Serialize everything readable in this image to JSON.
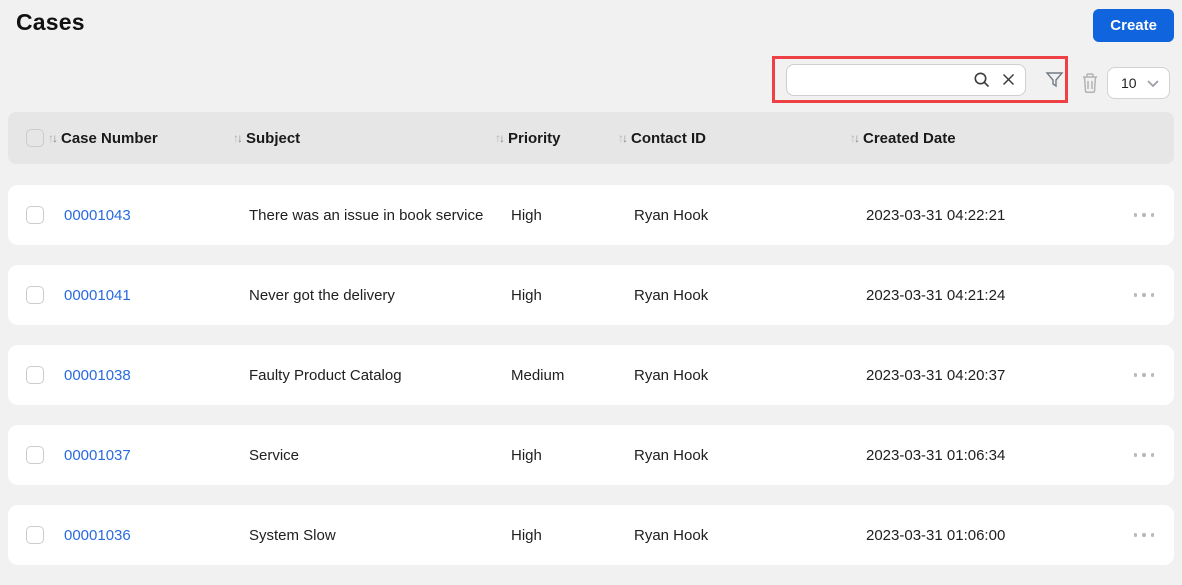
{
  "page": {
    "title": "Cases"
  },
  "toolbar": {
    "create_button": "Create",
    "search_input": {
      "value": "",
      "placeholder": ""
    },
    "icons": {
      "search": "search-icon",
      "clear": "close-icon",
      "filter": "funnel-icon",
      "delete": "trash-icon",
      "page_size": "chevron-down-icon"
    },
    "page_size_select": {
      "value": "10"
    }
  },
  "colors": {
    "accent_blue": "#1064dd",
    "link_blue": "#2a6ae0",
    "highlight_red": "#ee4045",
    "header_bg": "#e7e6e6",
    "page_bg": "#f2f1f1"
  },
  "table": {
    "columns": [
      {
        "key": "case_number",
        "label": "Case Number",
        "sortable": true
      },
      {
        "key": "subject",
        "label": "Subject",
        "sortable": true
      },
      {
        "key": "priority",
        "label": "Priority",
        "sortable": true
      },
      {
        "key": "contact",
        "label": "Contact ID",
        "sortable": true
      },
      {
        "key": "created_date",
        "label": "Created Date",
        "sortable": true
      }
    ],
    "rows": [
      {
        "case_number": "00001043",
        "subject": "There was an issue in book service",
        "priority": "High",
        "contact": "Ryan Hook",
        "created_date": "2023-03-31 04:22:21"
      },
      {
        "case_number": "00001041",
        "subject": "Never got the delivery",
        "priority": "High",
        "contact": "Ryan Hook",
        "created_date": "2023-03-31 04:21:24"
      },
      {
        "case_number": "00001038",
        "subject": "Faulty Product Catalog",
        "priority": "Medium",
        "contact": "Ryan Hook",
        "created_date": "2023-03-31 04:20:37"
      },
      {
        "case_number": "00001037",
        "subject": "Service",
        "priority": "High",
        "contact": "Ryan Hook",
        "created_date": "2023-03-31 01:06:34"
      },
      {
        "case_number": "00001036",
        "subject": "System Slow",
        "priority": "High",
        "contact": "Ryan Hook",
        "created_date": "2023-03-31 01:06:00"
      }
    ]
  }
}
